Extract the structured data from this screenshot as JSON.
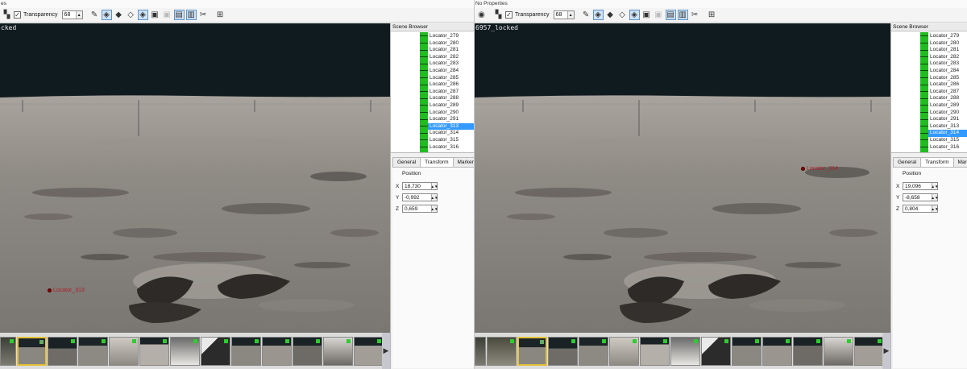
{
  "left": {
    "title": "es",
    "toolbar": {
      "transparency_label": "Transparency",
      "transparency_value": "68"
    },
    "viewport_label": "cked",
    "marker_label": "Locator_313",
    "scene_browser_title": "Scene Browser",
    "scene_items": [
      "Locator_279",
      "Locator_280",
      "Locator_281",
      "Locator_282",
      "Locator_283",
      "Locator_284",
      "Locator_285",
      "Locator_286",
      "Locator_287",
      "Locator_288",
      "Locator_289",
      "Locator_290",
      "Locator_291",
      "Locator_313",
      "Locator_314",
      "Locator_315",
      "Locator_316"
    ],
    "selected_item": "Locator_313",
    "tabs": [
      "General",
      "Transform",
      "Markers"
    ],
    "active_tab": "Transform",
    "position_label": "Position",
    "x_value": "18,730",
    "y_value": "-0,992",
    "z_value": "0,659"
  },
  "right": {
    "title": "No Properties",
    "toolbar": {
      "transparency_label": "Transparency",
      "transparency_value": "68"
    },
    "viewport_label": "6957_locked",
    "marker_label": "Locator_314",
    "scene_browser_title": "Scene Browser",
    "scene_items": [
      "Locator_279",
      "Locator_280",
      "Locator_281",
      "Locator_282",
      "Locator_283",
      "Locator_284",
      "Locator_285",
      "Locator_286",
      "Locator_287",
      "Locator_288",
      "Locator_289",
      "Locator_290",
      "Locator_291",
      "Locator_313",
      "Locator_314",
      "Locator_315",
      "Locator_316"
    ],
    "selected_item": "Locator_314",
    "tabs": [
      "General",
      "Transform",
      "Markers"
    ],
    "active_tab": "Transform",
    "position_label": "Position",
    "x_value": "19,096",
    "y_value": "-8,658",
    "z_value": "0,804"
  },
  "axes": {
    "x": "X",
    "y": "Y",
    "z": "Z"
  },
  "colors": {
    "selection": "#3399ff",
    "tree_green": "#22bb22",
    "marker": "#8b0000",
    "thumb_flag": "#2fcc2f",
    "selected_thumb": "#e2c238"
  },
  "icons": [
    "camera-icon",
    "checker-icon",
    "brush-icon",
    "cube-icon",
    "cube-solid-icon",
    "cube-wire-icon",
    "cube-select-icon",
    "cube-grid-icon",
    "cube-disabled-icon",
    "screen-icon",
    "screen-refresh-icon",
    "scissors-icon",
    "grid-icon"
  ]
}
